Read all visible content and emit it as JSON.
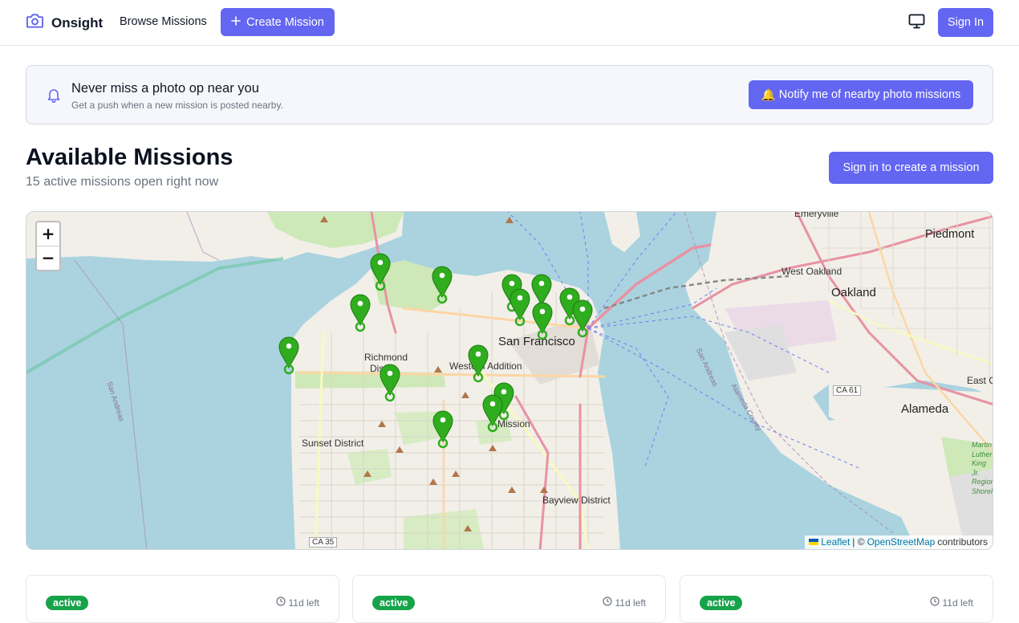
{
  "header": {
    "brand": "Onsight",
    "browse_label": "Browse Missions",
    "create_label": "Create Mission",
    "signin_label": "Sign In",
    "icons": [
      "camera-icon",
      "plus-icon",
      "monitor-icon"
    ]
  },
  "banner": {
    "title": "Never miss a photo op near you",
    "subtitle": "Get a push when a new mission is posted nearby.",
    "button_label": "Notify me of nearby photo missions",
    "button_emoji": "🔔"
  },
  "page": {
    "title": "Available Missions",
    "subtitle": "15 active missions open right now",
    "create_button": "Sign in to create a mission"
  },
  "map": {
    "zoom_in": "+",
    "zoom_out": "−",
    "attribution": {
      "leaflet": "Leaflet",
      "separator": "| ©",
      "osm": "OpenStreetMap",
      "suffix": "contributors"
    },
    "labels": {
      "san_francisco": "San Francisco",
      "oakland": "Oakland",
      "alameda": "Alameda",
      "emeryville": "Emeryville",
      "piedmont": "Piedmont",
      "west_oakland": "West Oakland",
      "richmond": "Richmond",
      "richmond_dist": "Dis",
      "western_addition": "Western Addition",
      "sunset_district": "Sunset District",
      "mission": "Mission",
      "bayview_district": "Bayview District",
      "east_o": "East O",
      "ca35": "CA 35",
      "ca61": "CA 61",
      "san_andreas": "San Andreas",
      "san_andreas_2": "San Andreas",
      "alameda_county": "Alameda County",
      "martin_luther": "Martin Luther King Jr. Regional Shoreline"
    },
    "marker_count": 15
  },
  "cards": [
    {
      "status": "active",
      "time_left": "11d left"
    },
    {
      "status": "active",
      "time_left": "11d left"
    },
    {
      "status": "active",
      "time_left": "11d left"
    }
  ],
  "colors": {
    "accent": "#6366f1",
    "active_badge": "#16a34a",
    "marker": "#2fad1e",
    "water": "#aad3df"
  }
}
